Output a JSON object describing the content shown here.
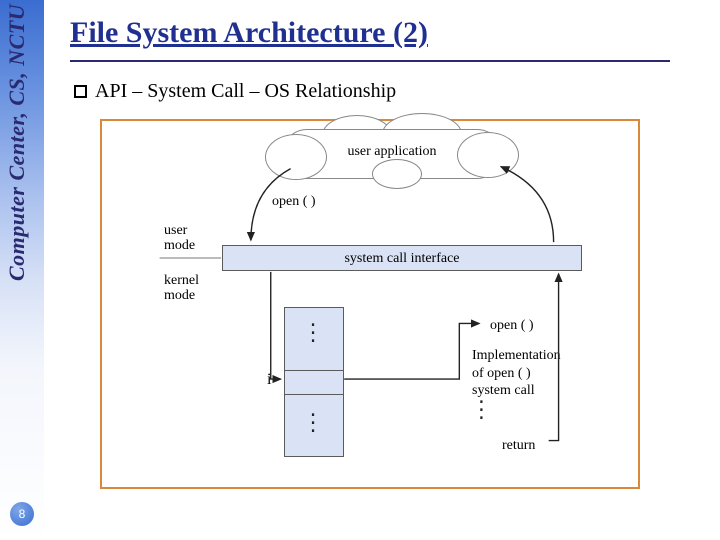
{
  "sidebar": {
    "org": "Computer Center, CS, NCTU",
    "page": "8"
  },
  "title": "File System Architecture (2)",
  "bullet": "API – System Call – OS Relationship",
  "fig": {
    "cloud": "user application",
    "open_call": "open ( )",
    "user_mode": "user\nmode",
    "kernel_mode": "kernel\nmode",
    "sci": "system call interface",
    "i": "i",
    "open_call2": "open ( )",
    "impl": "Implementation\nof open ( )\nsystem call",
    "return": "return"
  }
}
